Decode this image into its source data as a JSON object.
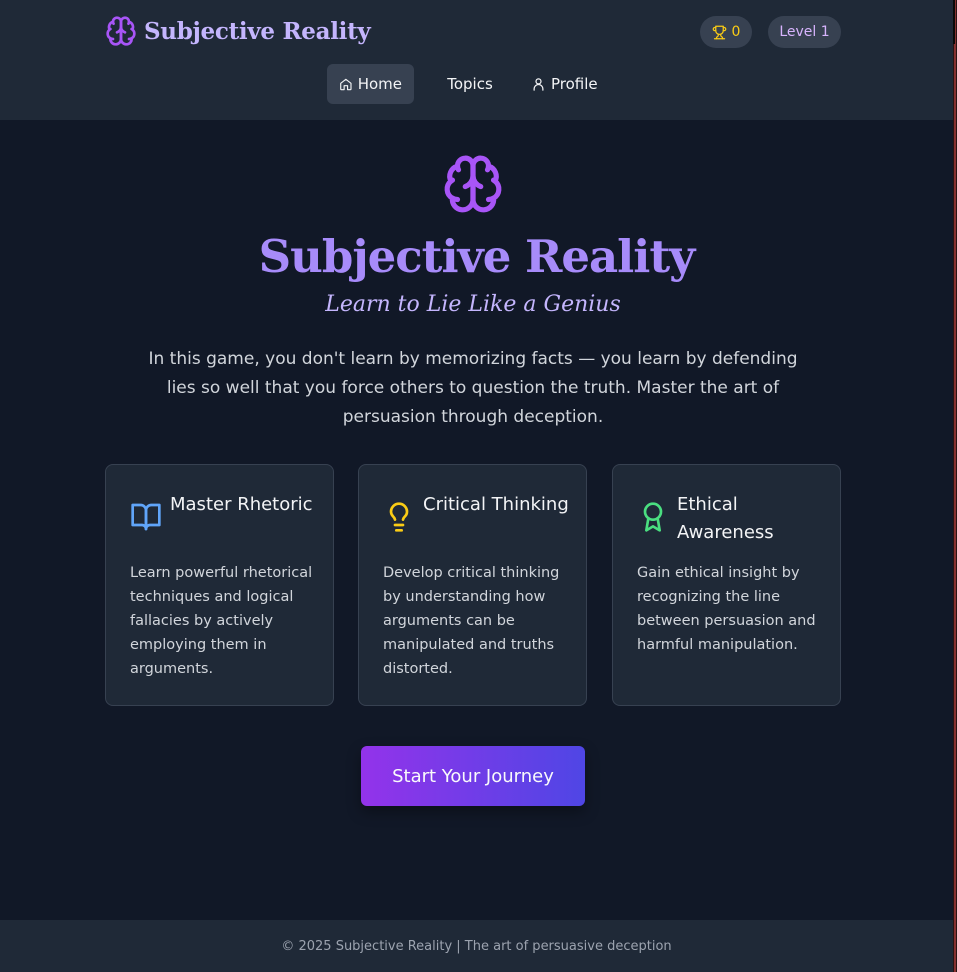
{
  "header": {
    "brand": {
      "name": "Subjective Reality",
      "icon": "brain-icon"
    },
    "trophy": {
      "icon": "trophy-icon",
      "count": "0"
    },
    "level_label": "Level 1",
    "nav": [
      {
        "label": "Home",
        "icon": "home-icon",
        "active": true
      },
      {
        "label": "Topics",
        "active": false
      },
      {
        "label": "Profile",
        "icon": "user-icon",
        "active": false
      }
    ]
  },
  "hero": {
    "icon": "brain-icon",
    "title": "Subjective Reality",
    "subtitle": "Learn to Lie Like a Genius",
    "intro": "In this game, you don't learn by memorizing facts — you learn by defending lies so well that you force others to question the truth. Master the art of persuasion through deception."
  },
  "features": [
    {
      "icon": "book-open-icon",
      "title": "Master Rhetoric",
      "description": "Learn powerful rhetorical techniques and logical fallacies by actively employing them in arguments.",
      "color": "#60a5fa"
    },
    {
      "icon": "lightbulb-icon",
      "title": "Critical Thinking",
      "description": "Develop critical thinking by understanding how arguments can be manipulated and truths distorted.",
      "color": "#facc15"
    },
    {
      "icon": "award-icon",
      "title": "Ethical Awareness",
      "description": "Gain ethical insight by recognizing the line between persuasion and harmful manipulation.",
      "color": "#4ade80"
    }
  ],
  "cta_label": "Start Your Journey",
  "footer": {
    "text": "© 2025 Subjective Reality | The art of persuasive deception"
  },
  "colors": {
    "accent": "#a78bfa",
    "background": "#111827",
    "surface": "#1f2937"
  }
}
